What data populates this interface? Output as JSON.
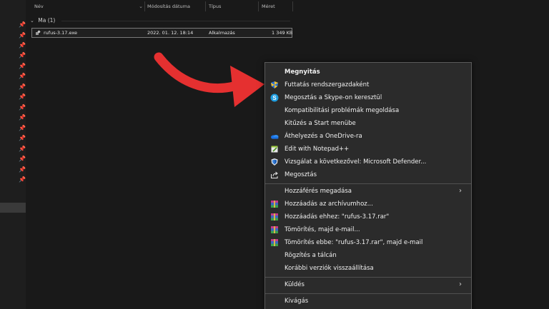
{
  "columns": {
    "name": "Név",
    "modified": "Módosítás dátuma",
    "type": "Típus",
    "size": "Méret"
  },
  "group": {
    "label": "Ma (1)"
  },
  "file": {
    "name": "rufus-3.17.exe",
    "modified": "2022. 01. 12. 18:14",
    "type": "Alkalmazás",
    "size": "1 349 KB"
  },
  "arrow_color": "#e53030",
  "context_menu": {
    "items": [
      {
        "label": "Megnyitás",
        "icon": "none",
        "bold": true
      },
      {
        "label": "Futtatás rendszergazdaként",
        "icon": "uac-shield-icon"
      },
      {
        "label": "Megosztás a Skype-on keresztül",
        "icon": "skype-icon"
      },
      {
        "label": "Kompatibilitási problémák megoldása",
        "icon": "none"
      },
      {
        "label": "Kitűzés a Start menübe",
        "icon": "none"
      },
      {
        "label": "Áthelyezés a OneDrive-ra",
        "icon": "onedrive-icon"
      },
      {
        "label": "Edit with Notepad++",
        "icon": "notepadpp-icon"
      },
      {
        "label": "Vizsgálat a következővel: Microsoft Defender...",
        "icon": "defender-icon"
      },
      {
        "label": "Megosztás",
        "icon": "share-icon"
      },
      {
        "label": "Hozzáférés megadása",
        "icon": "none",
        "submenu": true
      },
      {
        "label": "Hozzáadás az archívumhoz...",
        "icon": "winrar-icon"
      },
      {
        "label": "Hozzáadás ehhez: \"rufus-3.17.rar\"",
        "icon": "winrar-icon"
      },
      {
        "label": "Tömörítés, majd e-mail...",
        "icon": "winrar-icon"
      },
      {
        "label": "Tömörítés ebbe: \"rufus-3.17.rar\", majd e-mail",
        "icon": "winrar-icon"
      },
      {
        "label": "Rögzítés a tálcán",
        "icon": "none"
      },
      {
        "label": "Korábbi verziók visszaállítása",
        "icon": "none"
      },
      {
        "label": "Küldés",
        "icon": "none",
        "submenu": true
      },
      {
        "label": "Kivágás",
        "icon": "none"
      }
    ]
  }
}
